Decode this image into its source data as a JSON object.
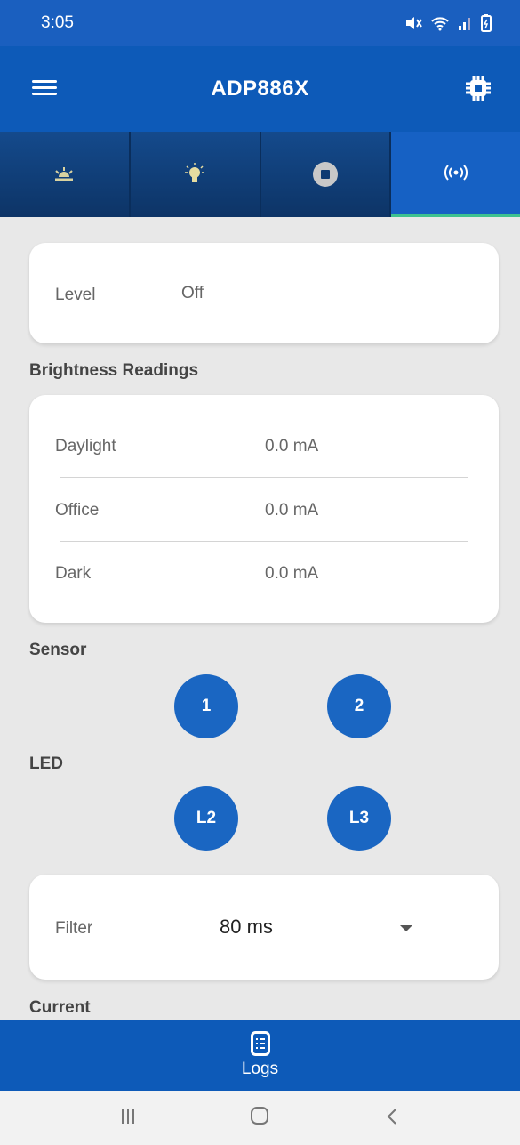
{
  "status_bar": {
    "time": "3:05"
  },
  "app_bar": {
    "title": "ADP886X"
  },
  "level_card": {
    "label": "Level",
    "value": "Off"
  },
  "brightness": {
    "title": "Brightness Readings",
    "rows": [
      {
        "label": "Daylight",
        "value": "0.0 mA"
      },
      {
        "label": "Office",
        "value": "0.0 mA"
      },
      {
        "label": "Dark",
        "value": "0.0 mA"
      }
    ]
  },
  "sensor": {
    "title": "Sensor",
    "buttons": [
      "1",
      "2"
    ]
  },
  "led": {
    "title": "LED",
    "buttons": [
      "L2",
      "L3"
    ]
  },
  "filter": {
    "label": "Filter",
    "value": "80 ms"
  },
  "current": {
    "title": "Current"
  },
  "bottom_bar": {
    "label": "Logs"
  },
  "colors": {
    "primary": "#0d5ab8",
    "accent": "#3ec28f",
    "button": "#1a66c2"
  },
  "icons": [
    "menu-icon",
    "chip-icon",
    "sunrise-icon",
    "bulb-icon",
    "stop-icon",
    "broadcast-icon",
    "logs-icon"
  ]
}
